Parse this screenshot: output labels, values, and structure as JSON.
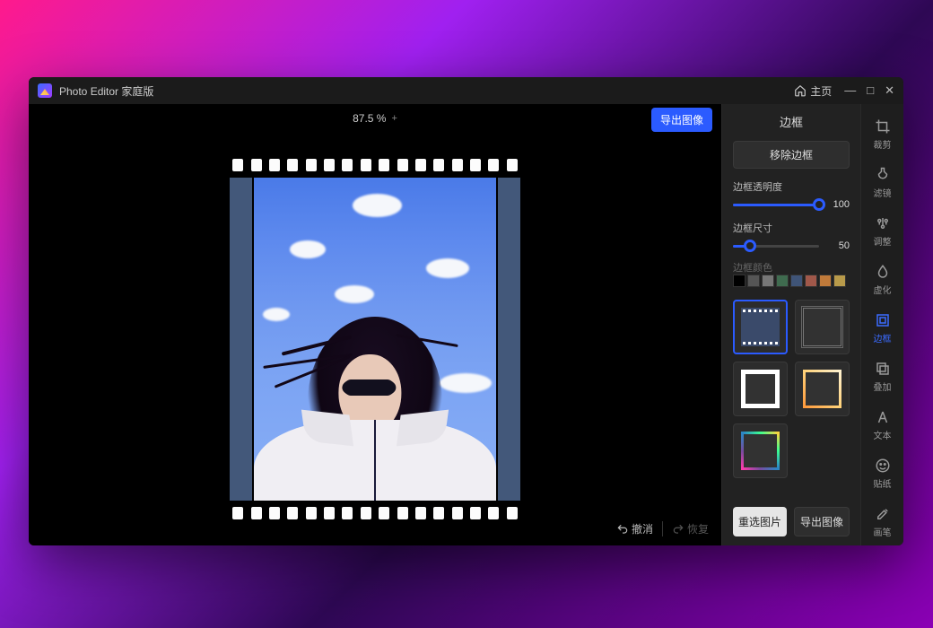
{
  "titlebar": {
    "app_name": "Photo Editor 家庭版",
    "home_label": "主页"
  },
  "canvas": {
    "zoom": "87.5 %",
    "export_button": "导出图像",
    "undo_label": "撤消",
    "redo_label": "恢复"
  },
  "props": {
    "title": "边框",
    "remove_frame": "移除边框",
    "opacity_label": "边框透明度",
    "opacity_value": "100",
    "size_label": "边框尺寸",
    "size_value": "50",
    "color_label": "边框颜色",
    "swatches": [
      "#000000",
      "#555555",
      "#777777",
      "#3f6b4f",
      "#3f5477",
      "#a0584a",
      "#c07a3a",
      "#b89a4a"
    ],
    "reselect_button": "重选图片",
    "export_button": "导出图像"
  },
  "tools": {
    "crop": "裁剪",
    "filter": "滤镜",
    "adjust": "调整",
    "blur": "虚化",
    "frame": "边框",
    "overlay": "叠加",
    "text": "文本",
    "sticker": "贴纸",
    "brush": "画笔"
  }
}
